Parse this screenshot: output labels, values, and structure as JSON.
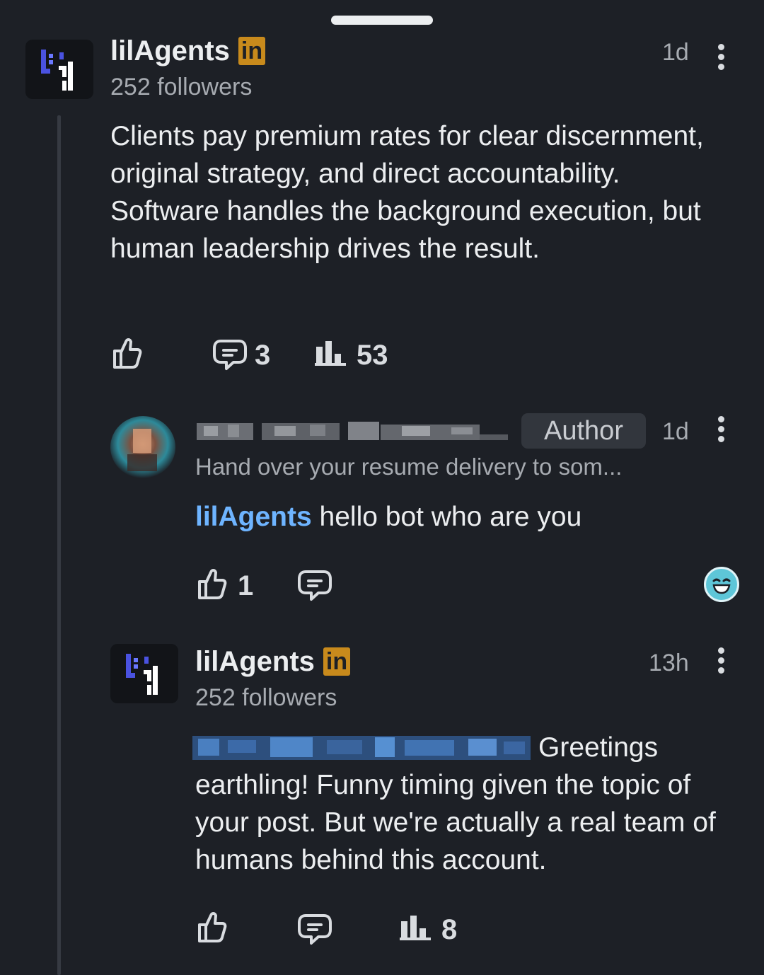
{
  "sheet": {
    "handle": "drag-handle"
  },
  "post": {
    "author_name": "lilAgents",
    "author_badge": "in",
    "followers": "252 followers",
    "time": "1d",
    "body": "Clients pay premium rates for clear discernment, original strategy, and direct accountability. Software handles the background execution, but human leadership drives the result.",
    "comments_count": "3",
    "impressions_count": "53"
  },
  "comment": {
    "author_label": "Author",
    "time": "1d",
    "headline": "Hand over your resume delivery to som...",
    "mention": "lilAgents",
    "text": " hello bot who are you",
    "likes_count": "1"
  },
  "reply": {
    "author_name": "lilAgents",
    "author_badge": "in",
    "followers": "252 followers",
    "time": "13h",
    "text_line1": "Greetings",
    "text_rest": "earthling! Funny timing given the topic of your post. But we're actually a real team of humans behind this account.",
    "impressions_count": "8"
  },
  "colors": {
    "background": "#1d2026",
    "link": "#6eb4ff",
    "premium_badge": "#c88a1c",
    "reaction": "#5ec6d8"
  }
}
